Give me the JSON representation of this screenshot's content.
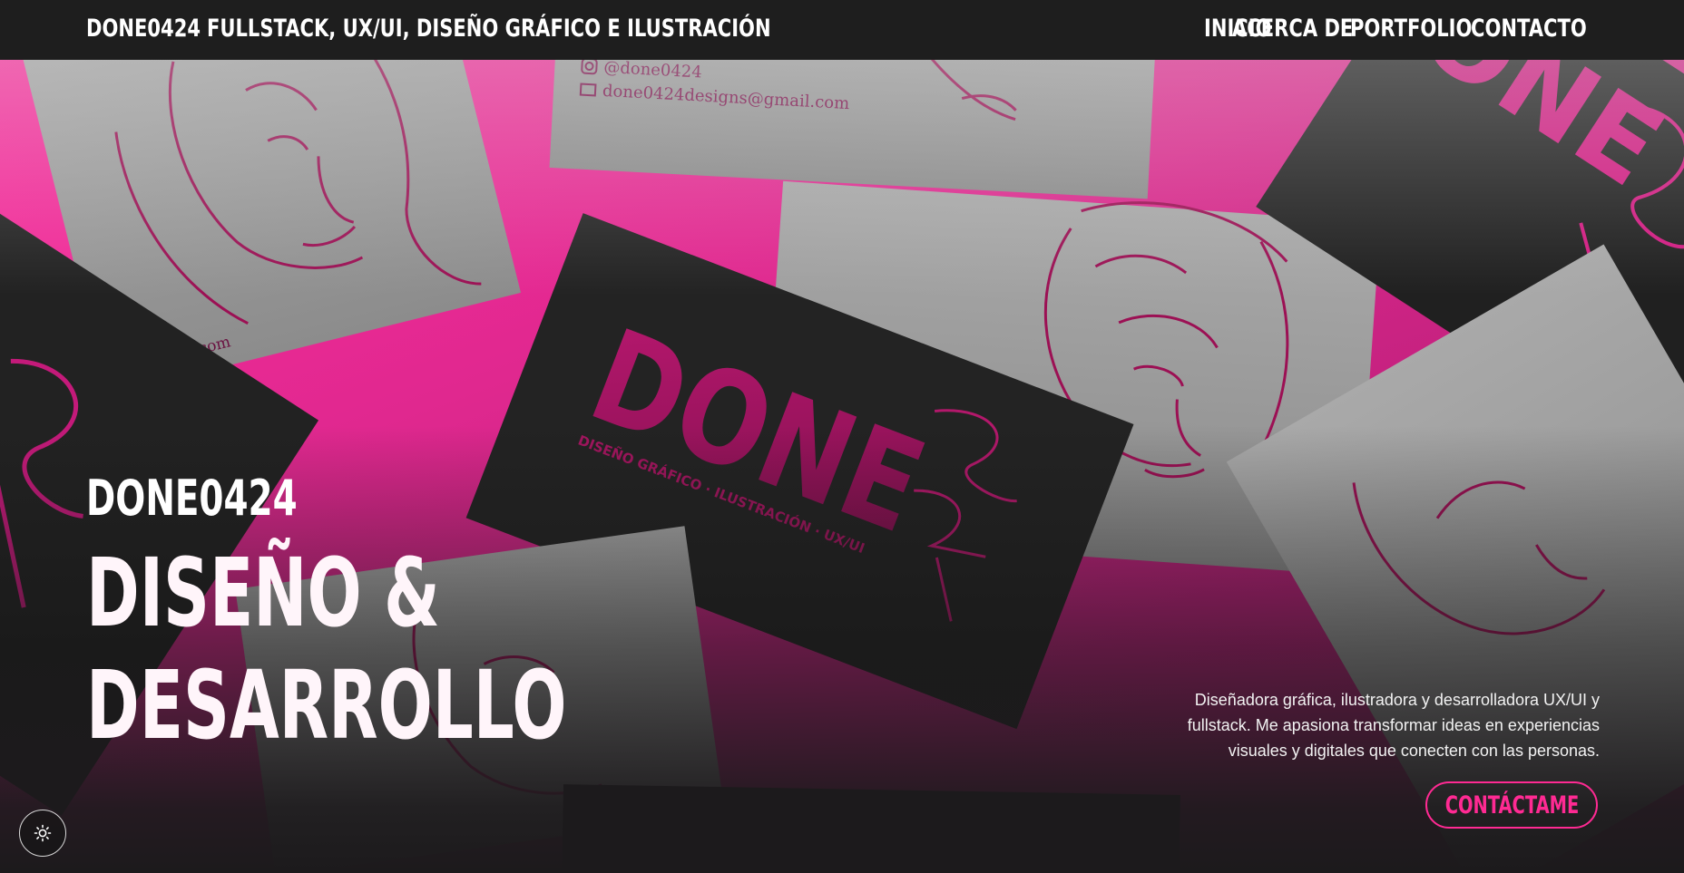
{
  "header": {
    "brand": "DONE0424",
    "tagline": "FULLSTACK, UX/UI, DISEÑO GRÁFICO E ILUSTRACIÓN",
    "nav": [
      {
        "label": "INICIO"
      },
      {
        "label": "ACERCA DE"
      },
      {
        "label": "PORTFOLIO"
      },
      {
        "label": "CONTACTO"
      }
    ]
  },
  "hero": {
    "brand": "DONE0424",
    "title_line1": "DISEÑO &",
    "title_line2": "DESARROLLO",
    "description": "Diseñadora gráfica, ilustradora y desarrolladora UX/UI y fullstack. Me apasiona transformar ideas en experiencias visuales y digitales que conecten con las personas.",
    "cta_label": "CONTÁCTAME",
    "theme_toggle_icon": "sun-icon"
  },
  "mockup": {
    "instagram": "@done0424",
    "email": "done0424designs@gmail.com",
    "email_partial": "@gmail.com",
    "card_logo": "DONE",
    "card_subtitle": "DISEÑO GRÁFICO · ILUSTRACIÓN · UX/UI",
    "card_logo_number": "24"
  },
  "colors": {
    "accent": "#ff2a93",
    "background_pink": "#e0288f",
    "card_dark": "#222222",
    "card_gray": "#9a9a9a",
    "line_art": "#9c1054"
  }
}
